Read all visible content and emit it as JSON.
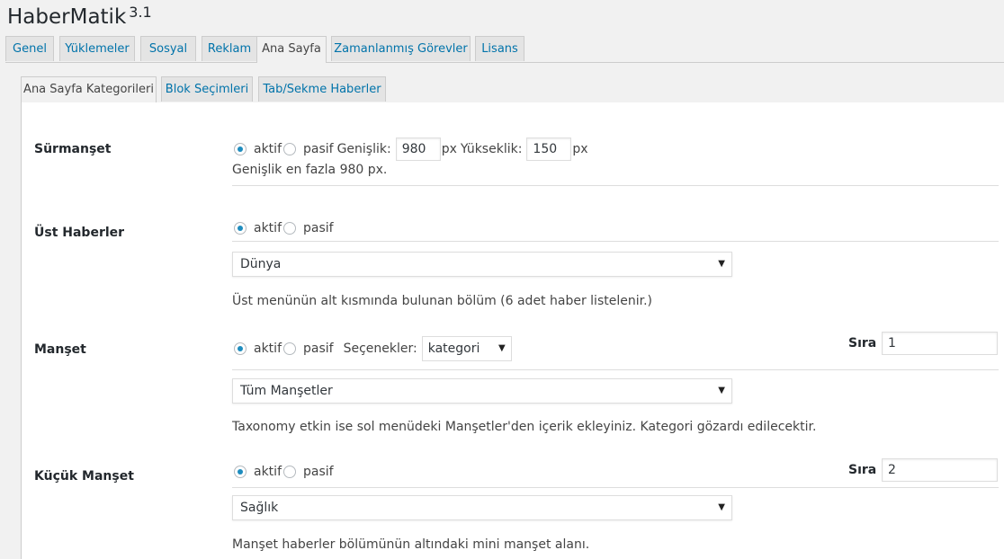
{
  "app": {
    "title": "HaberMatik",
    "version": "3.1"
  },
  "main_tabs": [
    {
      "label": "Genel"
    },
    {
      "label": "Yüklemeler"
    },
    {
      "label": "Sosyal"
    },
    {
      "label": "Reklam"
    },
    {
      "label": "Ana Sayfa",
      "active": true
    },
    {
      "label": "Zamanlanmış Görevler"
    },
    {
      "label": "Lisans"
    }
  ],
  "sub_tabs": [
    {
      "label": "Ana Sayfa Kategorileri",
      "active": true
    },
    {
      "label": "Blok Seçimleri"
    },
    {
      "label": "Tab/Sekme Haberler"
    }
  ],
  "radio": {
    "on": "aktif",
    "off": "pasif"
  },
  "surmanset": {
    "label": "Sürmanşet",
    "width_label": "Genişlik:",
    "width_value": "980",
    "width_unit": "px",
    "height_label": "Yükseklik:",
    "height_value": "150",
    "height_unit": "px",
    "help": "Genişlik en fazla 980 px."
  },
  "ust_haberler": {
    "label": "Üst Haberler",
    "selected": "Dünya",
    "help": "Üst menünün alt kısmında bulunan bölüm (6 adet haber listelenir.)"
  },
  "manset": {
    "label": "Manşet",
    "options_label": "Seçenekler:",
    "options_value": "kategori",
    "sira_label": "Sıra",
    "sira_value": "1",
    "selected": "Tüm Manşetler",
    "help": "Taxonomy etkin ise sol menüdeki Manşetler'den içerik ekleyiniz. Kategori gözardı edilecektir."
  },
  "kucuk_manset": {
    "label": "Küçük Manşet",
    "sira_label": "Sıra",
    "sira_value": "2",
    "selected": "Sağlık",
    "help": "Manşet haberler bölümünün altındaki mini manşet alanı."
  },
  "colors": {
    "link": "#0073aa",
    "radio_dot": "#1e8cbe",
    "panel_bg": "#ffffff",
    "page_bg": "#f1f1f1"
  }
}
